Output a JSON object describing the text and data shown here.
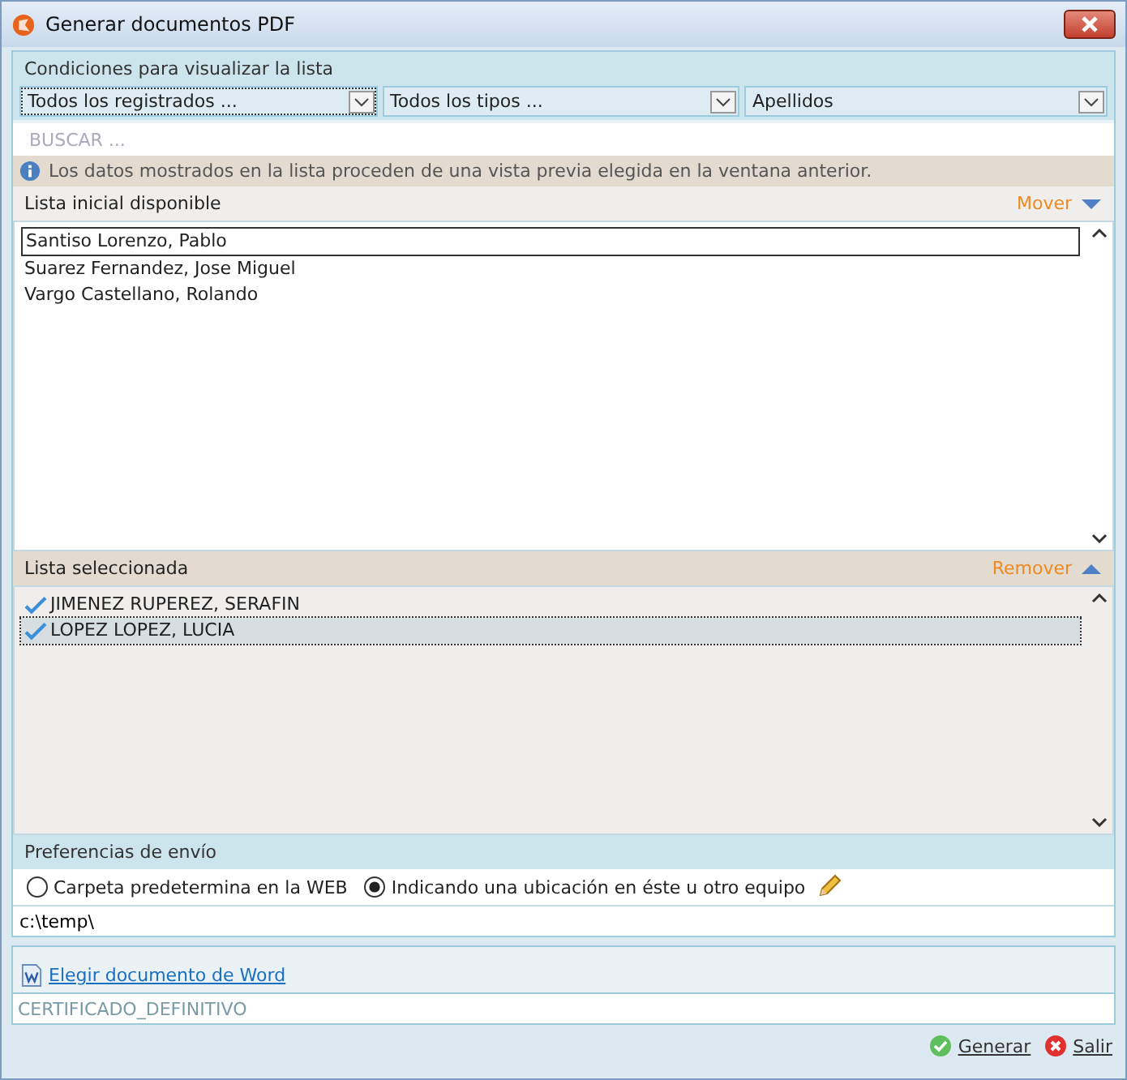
{
  "window": {
    "title": "Generar documentos PDF"
  },
  "conditions": {
    "title": "Condiciones para visualizar la lista",
    "dropdowns": [
      {
        "value": "Todos los registrados ...",
        "selected": true
      },
      {
        "value": "Todos los tipos ...",
        "selected": false
      },
      {
        "value": "Apellidos",
        "selected": false
      }
    ]
  },
  "search": {
    "placeholder": "BUSCAR ..."
  },
  "info": "Los datos mostrados en la lista proceden de una vista previa elegida en la ventana anterior.",
  "available": {
    "title": "Lista inicial disponible",
    "action": "Mover",
    "items": [
      {
        "label": "Santiso Lorenzo, Pablo",
        "selected": true
      },
      {
        "label": "Suarez Fernandez, Jose Miguel",
        "selected": false
      },
      {
        "label": "Vargo Castellano, Rolando",
        "selected": false
      }
    ]
  },
  "chosen": {
    "title": "Lista seleccionada",
    "action": "Remover",
    "items": [
      {
        "label": "JIMENEZ RUPEREZ, SERAFIN",
        "checked": true,
        "selected": false
      },
      {
        "label": "LOPEZ LOPEZ, LUCIA",
        "checked": true,
        "selected": true
      }
    ]
  },
  "preferences": {
    "title": "Preferencias de envío",
    "options": [
      {
        "label": "Carpeta predetermina en la WEB",
        "selected": false
      },
      {
        "label": "Indicando una ubicación en éste u otro equipo",
        "selected": true
      }
    ],
    "path": "c:\\temp\\"
  },
  "word": {
    "link": "Elegir documento de Word",
    "document": "CERTIFICADO_DEFINITIVO"
  },
  "buttons": [
    {
      "label": "Generar",
      "kind": "ok"
    },
    {
      "label": "Salir",
      "kind": "cancel"
    }
  ]
}
